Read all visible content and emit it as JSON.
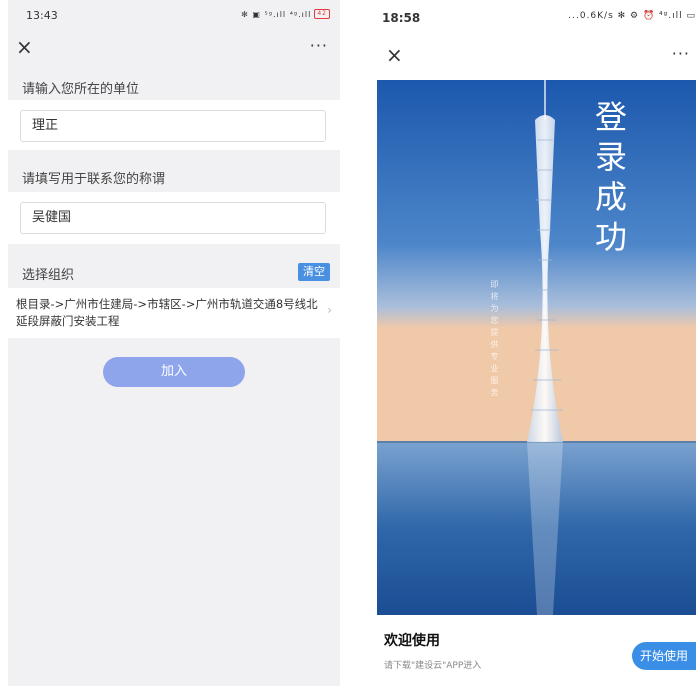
{
  "left": {
    "status": {
      "time": "13:43",
      "icons": "✻ ▣ ⁵ᵍ.ıll ⁴ᵍ.ıll",
      "battery": "42"
    },
    "nav": {
      "close": "×",
      "more": "···"
    },
    "unit": {
      "label": "请输入您所在的单位",
      "value": "理正"
    },
    "name": {
      "label": "请填写用于联系您的称谓",
      "value": "吴健国"
    },
    "org": {
      "label": "选择组织",
      "clear_label": "清空",
      "path": "根目录->广州市住建局->市辖区->广州市轨道交通8号线北延段屏蔽门安装工程"
    },
    "join_label": "加入"
  },
  "right": {
    "status": {
      "time": "18:58",
      "icons": "...0.6K/s ✻ ⚙ ⏰ ⁴ᵍ.ıll ▭"
    },
    "nav": {
      "close": "×",
      "more": "···"
    },
    "hero": {
      "title": "登录成功",
      "subtitle": "即将为您提供专业服务"
    },
    "welcome": "欢迎使用",
    "welcome_sub": "请下载\"建设云\"APP进入",
    "start_label": "开始使用"
  },
  "colors": {
    "accent_blue": "#4a90e2",
    "join_button": "#8ea5ec",
    "start_button": "#3a8ee6",
    "sky_top": "#1f5fb3",
    "horizon": "#f0c9a8"
  }
}
